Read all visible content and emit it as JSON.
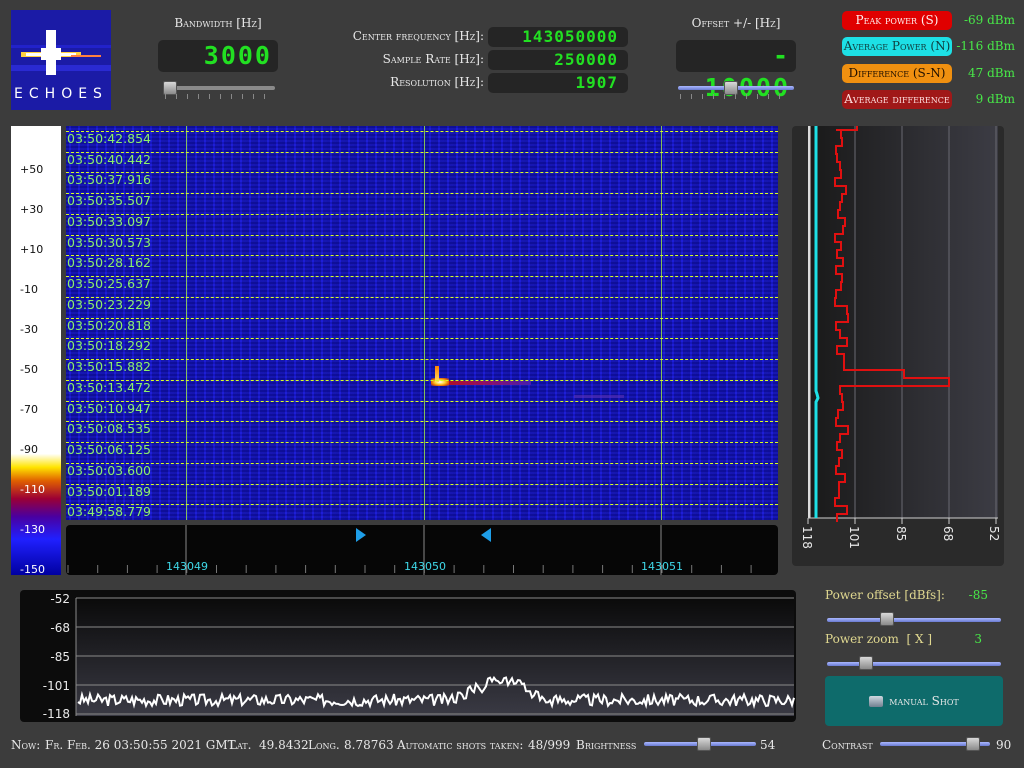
{
  "app": {
    "logo_text": "ECHOES"
  },
  "top": {
    "bandwidth": {
      "label": "Bandwidth [Hz]",
      "value": "3000",
      "slider": 0.03
    },
    "center_frequency": {
      "label": "Center frequency [Hz]:",
      "value": "143050000"
    },
    "sample_rate": {
      "label": "Sample Rate [Hz]:",
      "value": "250000"
    },
    "resolution": {
      "label": "Resolution [Hz]:",
      "value": "1907"
    },
    "offset": {
      "label": "Offset +/- [Hz]",
      "value": "- 10000",
      "slider": 0.45
    }
  },
  "power": {
    "peak": {
      "label": "Peak power (S)",
      "value": "-69 dBm",
      "color": "#e00000"
    },
    "average": {
      "label": "Average Power (N)",
      "value": "-116 dBm",
      "color": "#1de0e6"
    },
    "difference": {
      "label": "Difference (S-N)",
      "value": "47 dBm",
      "color": "#f09010"
    },
    "avg_difference": {
      "label": "Average difference",
      "value": "9 dBm",
      "color": "#a01818"
    }
  },
  "colorbar": {
    "labels": [
      "+50",
      "+30",
      "+10",
      "-10",
      "-30",
      "-50",
      "-70",
      "-90",
      "-110",
      "-130",
      "-150"
    ]
  },
  "waterfall": {
    "timestamps": [
      "03:50:42.854",
      "03:50:40.442",
      "03:50:37.916",
      "03:50:35.507",
      "03:50:33.097",
      "03:50:30.573",
      "03:50:28.162",
      "03:50:25.637",
      "03:50:23.229",
      "03:50:20.818",
      "03:50:18.292",
      "03:50:15.882",
      "03:50:13.472",
      "03:50:10.947",
      "03:50:08.535",
      "03:50:06.125",
      "03:50:03.600",
      "03:50:01.189",
      "03:49:58.779"
    ],
    "freq_labels": [
      "143049",
      "143050",
      "143051"
    ]
  },
  "right_plot": {
    "tick_labels": [
      "118",
      "101",
      "85",
      "68",
      "52"
    ]
  },
  "spectrum": {
    "y_labels": [
      "-52",
      "-68",
      "-85",
      "-101",
      "-118"
    ]
  },
  "controls": {
    "power_offset": {
      "label": "Power offset [dBfs]:",
      "value": "-85",
      "slider": 0.33
    },
    "power_zoom": {
      "label": "Power zoom  [ X ]",
      "value": "3",
      "slider": 0.2
    },
    "manual_shot": "manual Shot"
  },
  "status": {
    "now_label": "Now:",
    "now_value": "Fr. Feb. 26 03:50:55 2021 GMT",
    "lat_label": "Lat.",
    "lat_value": "49.8432",
    "long_label": "Long.",
    "long_value": "8.78763",
    "shots_label": "Automatic shots taken:",
    "shots_value": "48/999",
    "brightness_label": "Brightness",
    "brightness_value": "54",
    "brightness_slider": 0.54,
    "contrast_label": "Contrast",
    "contrast_value": "90",
    "contrast_slider": 0.9
  }
}
